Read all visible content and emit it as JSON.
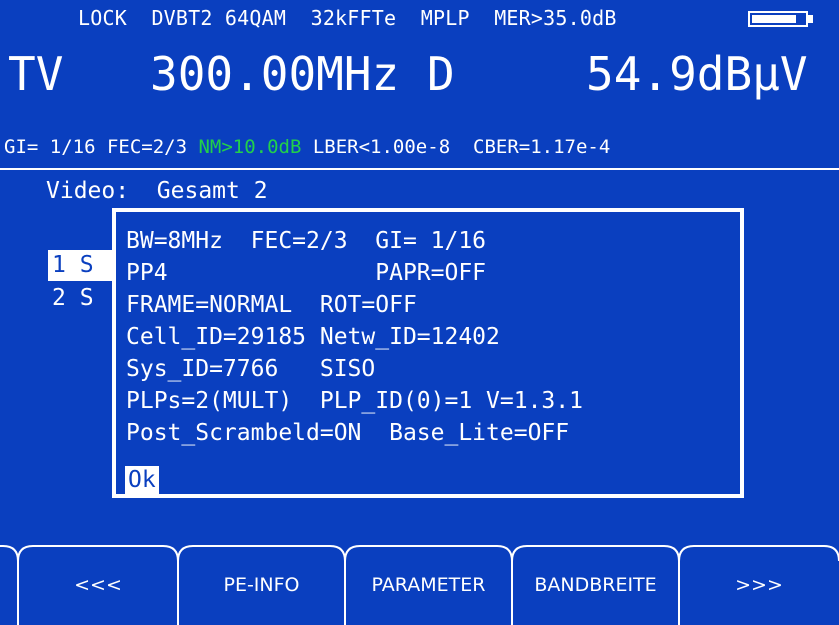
{
  "status_line": "LOCK  DVBT2 64QAM  32kFFTe  MPLP  MER>35.0dB",
  "battery_level": 0.85,
  "main": {
    "mode": "TV",
    "frequency": "300.00MHz D",
    "level": "54.9dBµV"
  },
  "info_line": {
    "gi_fec": "GI= 1/16 FEC=2/3 ",
    "nm": "NM>10.0dB",
    "ber": " LBER<1.00e-8  CBER=1.17e-4"
  },
  "video": {
    "title": "Video:  Gesamt 2",
    "items": [
      "1 S",
      "2 S"
    ]
  },
  "dialog": {
    "lines": [
      "BW=8MHz  FEC=2/3  GI= 1/16",
      "PP4               PAPR=OFF",
      "FRAME=NORMAL  ROT=OFF",
      "Cell_ID=29185 Netw_ID=12402",
      "Sys_ID=7766   SISO",
      "PLPs=2(MULT)  PLP_ID(0)=1 V=1.3.1",
      "Post_Scrambeld=ON  Base_Lite=OFF"
    ],
    "ok_label": "Ok"
  },
  "softkeys": [
    "<<<",
    "PE-INFO",
    "PARAMETER",
    "BANDBREITE",
    ">>>"
  ],
  "colors": {
    "background": "#0a3fbf",
    "foreground": "#ffffff",
    "accent_green": "#22d04a"
  }
}
